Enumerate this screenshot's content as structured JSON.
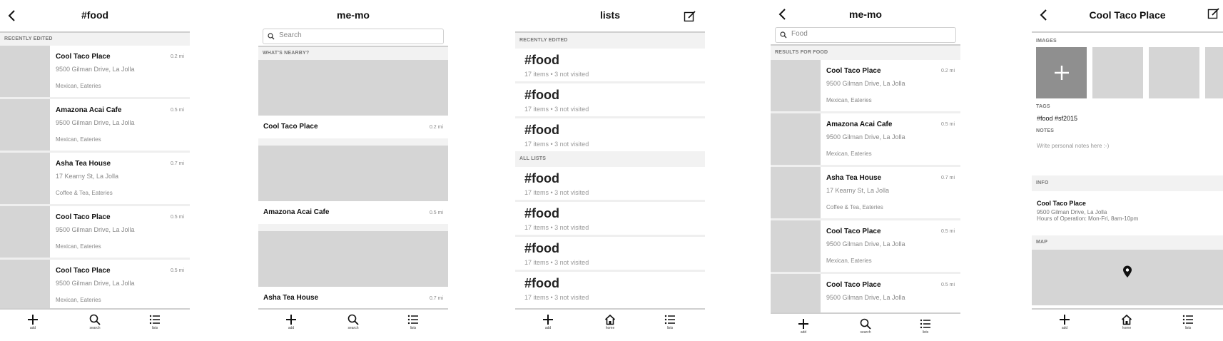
{
  "places": [
    {
      "name": "Cool Taco Place",
      "address": "9500 Gilman Drive, La Jolla",
      "category": "Mexican, Eateries",
      "distance": "0.2 mi"
    },
    {
      "name": "Amazona Acai Cafe",
      "address": "9500 Gilman Drive, La Jolla",
      "category": "Mexican, Eateries",
      "distance": "0.5 mi"
    },
    {
      "name": "Asha Tea House",
      "address": "17 Kearny St, La Jolla",
      "category": "Coffee & Tea, Eateries",
      "distance": "0.7 mi"
    },
    {
      "name": "Cool Taco Place",
      "address": "9500 Gilman Drive, La Jolla",
      "category": "Mexican, Eateries",
      "distance": "0.5 mi"
    },
    {
      "name": "Cool Taco Place",
      "address": "9500 Gilman Drive, La Jolla",
      "category": "Mexican, Eateries",
      "distance": "0.5 mi"
    }
  ],
  "screen1": {
    "title": "#food",
    "section": "RECENTLY EDITED",
    "tabs": {
      "add": "add",
      "search": "search",
      "lists": "lists"
    }
  },
  "screen2": {
    "title": "me-mo",
    "search_placeholder": "Search",
    "section": "WHAT'S NEARBY?",
    "cards": [
      {
        "name": "Cool Taco Place",
        "distance": "0.2 mi"
      },
      {
        "name": "Amazona Acai Cafe",
        "distance": "0.5 mi"
      },
      {
        "name": "Asha Tea House",
        "distance": "0.7 mi"
      }
    ],
    "tabs": {
      "add": "add",
      "search": "search",
      "lists": "lists"
    }
  },
  "screen3": {
    "title": "lists",
    "section_recent": "RECENTLY EDITED",
    "section_all": "ALL LISTS",
    "recent": [
      {
        "name": "#food",
        "meta": "17 items • 3 not visited"
      },
      {
        "name": "#food",
        "meta": "17 items • 3 not visited"
      },
      {
        "name": "#food",
        "meta": "17 items • 3 not visited"
      }
    ],
    "all": [
      {
        "name": "#food",
        "meta": "17 items • 3 not visited"
      },
      {
        "name": "#food",
        "meta": "17 items • 3 not visited"
      },
      {
        "name": "#food",
        "meta": "17 items • 3 not visited"
      },
      {
        "name": "#food",
        "meta": "17 items • 3 not visited"
      }
    ],
    "tabs": {
      "add": "add",
      "home": "home",
      "lists": "lists"
    }
  },
  "screen4": {
    "title": "me-mo",
    "search_value": "Food",
    "section": "RESULTS FOR FOOD",
    "tabs": {
      "add": "add",
      "search": "search",
      "lists": "lists"
    }
  },
  "screen5": {
    "title": "Cool Taco Place",
    "images_label": "IMAGES",
    "tags_label": "TAGS",
    "tags": "#food #sf2015",
    "notes_label": "NOTES",
    "notes_placeholder": "Write personal notes here :-)",
    "info_label": "INFO",
    "info_name": "Cool Taco Place",
    "info_address": "9500 Gilman Drive, La Jolla",
    "info_hours": "Hours of Operation: Mon-Fri, 8am-10pm",
    "map_label": "MAP",
    "tabs": {
      "add": "add",
      "home": "home",
      "lists": "lists"
    }
  },
  "colors": {
    "placeholder_gray": "#d5d5d5",
    "add_tile_gray": "#8f8f8f",
    "section_bg": "#f2f2f2"
  }
}
